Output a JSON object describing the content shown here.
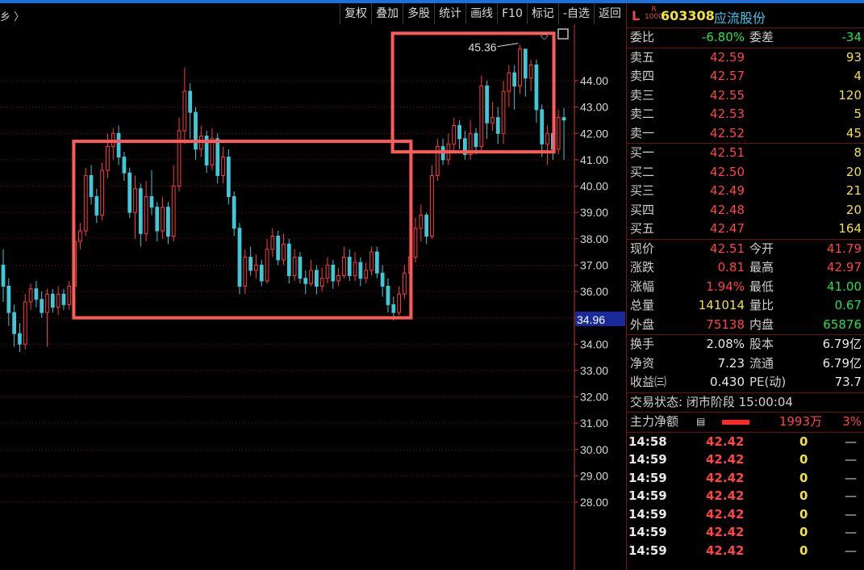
{
  "toolbar": {
    "left_fragment": "乡 〉",
    "buttons": [
      "复权",
      "叠加",
      "多股",
      "统计",
      "画线",
      "F10",
      "标记",
      "-自选",
      "返回"
    ]
  },
  "chart_data": {
    "type": "candlestick",
    "y_ticks": [
      44.0,
      43.0,
      42.0,
      41.0,
      40.0,
      39.0,
      38.0,
      37.0,
      36.0,
      35.0,
      34.0,
      33.0,
      32.0,
      31.0,
      30.0,
      29.0,
      28.0
    ],
    "ylim": [
      27.2,
      45.8
    ],
    "high_label": "45.36",
    "current_price_tag": "34.96",
    "colors": {
      "up": "#ff3b3b",
      "down": "#40c8d8",
      "box": "#ff5a5a",
      "grid": "#7a1414",
      "axis": "#d23030"
    },
    "candles": [
      [
        37.0,
        36.2,
        37.6,
        35.6
      ],
      [
        36.2,
        35.2,
        36.5,
        34.7
      ],
      [
        35.2,
        34.4,
        35.5,
        33.9
      ],
      [
        34.4,
        34.0,
        34.8,
        33.7
      ],
      [
        34.0,
        35.6,
        35.9,
        33.8
      ],
      [
        35.6,
        36.1,
        36.3,
        35.3
      ],
      [
        36.1,
        35.7,
        36.4,
        35.4
      ],
      [
        35.7,
        35.2,
        36.0,
        35.0
      ],
      [
        35.2,
        35.9,
        36.1,
        33.9
      ],
      [
        35.9,
        35.4,
        36.1,
        35.2
      ],
      [
        35.4,
        35.9,
        36.2,
        35.1
      ],
      [
        35.9,
        35.5,
        36.1,
        35.3
      ],
      [
        35.5,
        36.2,
        36.4,
        35.3
      ],
      [
        36.2,
        37.9,
        38.3,
        36.0
      ],
      [
        37.9,
        38.3,
        38.6,
        37.6
      ],
      [
        38.3,
        40.4,
        40.7,
        38.1
      ],
      [
        40.4,
        39.6,
        40.8,
        39.3
      ],
      [
        39.6,
        38.9,
        39.9,
        38.6
      ],
      [
        38.9,
        40.6,
        40.9,
        38.7
      ],
      [
        40.6,
        41.5,
        42.0,
        40.3
      ],
      [
        41.5,
        42.0,
        42.2,
        41.0
      ],
      [
        42.0,
        41.1,
        42.3,
        40.8
      ],
      [
        41.1,
        40.5,
        41.3,
        40.2
      ],
      [
        40.5,
        39.0,
        40.7,
        38.8
      ],
      [
        39.0,
        39.9,
        40.4,
        38.0
      ],
      [
        39.9,
        38.2,
        40.1,
        37.7
      ],
      [
        38.2,
        39.6,
        40.2,
        37.9
      ],
      [
        39.6,
        39.2,
        40.6,
        38.9
      ],
      [
        39.2,
        38.3,
        39.4,
        37.9
      ],
      [
        38.3,
        39.2,
        39.6,
        38.0
      ],
      [
        39.2,
        38.1,
        39.4,
        37.8
      ],
      [
        38.1,
        40.0,
        40.8,
        37.9
      ],
      [
        40.0,
        42.1,
        42.6,
        39.8
      ],
      [
        42.1,
        43.6,
        44.5,
        41.6
      ],
      [
        43.6,
        42.8,
        43.9,
        41.8
      ],
      [
        42.8,
        41.4,
        43.0,
        41.0
      ],
      [
        41.4,
        41.9,
        42.3,
        41.1
      ],
      [
        41.9,
        40.8,
        42.1,
        40.5
      ],
      [
        40.8,
        41.8,
        42.2,
        40.6
      ],
      [
        41.8,
        40.4,
        42.0,
        40.1
      ],
      [
        40.4,
        41.1,
        41.5,
        40.1
      ],
      [
        41.1,
        39.6,
        41.4,
        39.3
      ],
      [
        39.6,
        38.4,
        39.8,
        38.1
      ],
      [
        38.4,
        36.2,
        38.6,
        35.9
      ],
      [
        36.2,
        37.3,
        37.6,
        35.9
      ],
      [
        37.3,
        36.8,
        37.7,
        36.6
      ],
      [
        36.8,
        37.0,
        37.4,
        36.5
      ],
      [
        37.0,
        36.4,
        37.2,
        36.2
      ],
      [
        36.4,
        37.6,
        38.0,
        36.3
      ],
      [
        37.6,
        38.1,
        38.4,
        37.3
      ],
      [
        38.1,
        37.2,
        38.3,
        37.0
      ],
      [
        37.2,
        37.8,
        38.2,
        37.0
      ],
      [
        37.8,
        36.6,
        38.0,
        36.3
      ],
      [
        36.6,
        37.3,
        37.6,
        36.4
      ],
      [
        37.3,
        36.5,
        37.5,
        36.3
      ],
      [
        36.5,
        36.3,
        36.8,
        35.9
      ],
      [
        36.3,
        36.8,
        37.2,
        36.2
      ],
      [
        36.8,
        36.2,
        37.0,
        35.9
      ],
      [
        36.2,
        36.5,
        36.9,
        36.0
      ],
      [
        36.5,
        37.0,
        37.3,
        36.3
      ],
      [
        37.0,
        36.4,
        37.2,
        36.1
      ],
      [
        36.4,
        36.6,
        36.9,
        36.2
      ],
      [
        36.6,
        37.3,
        37.7,
        36.5
      ],
      [
        37.3,
        36.6,
        37.6,
        36.4
      ],
      [
        36.6,
        37.1,
        37.5,
        36.4
      ],
      [
        37.1,
        36.5,
        37.3,
        36.2
      ],
      [
        36.5,
        36.8,
        37.1,
        36.3
      ],
      [
        36.8,
        37.5,
        37.7,
        36.6
      ],
      [
        37.5,
        36.7,
        37.7,
        36.5
      ],
      [
        36.7,
        36.2,
        37.0,
        35.8
      ],
      [
        36.2,
        35.5,
        36.5,
        35.2
      ],
      [
        35.5,
        35.2,
        35.8,
        34.9
      ],
      [
        35.2,
        35.9,
        36.2,
        35.1
      ],
      [
        35.9,
        36.7,
        37.0,
        35.7
      ],
      [
        36.7,
        37.3,
        37.6,
        36.5
      ],
      [
        37.3,
        38.4,
        38.8,
        37.1
      ],
      [
        38.4,
        38.9,
        39.3,
        37.9
      ],
      [
        38.9,
        38.1,
        39.0,
        37.8
      ],
      [
        38.1,
        40.4,
        40.8,
        38.0
      ],
      [
        40.4,
        41.5,
        41.8,
        40.2
      ],
      [
        41.5,
        41.0,
        41.8,
        40.8
      ],
      [
        41.0,
        41.6,
        42.0,
        40.8
      ],
      [
        41.6,
        42.3,
        42.6,
        41.3
      ],
      [
        42.3,
        41.8,
        42.5,
        41.4
      ],
      [
        41.8,
        41.2,
        42.1,
        41.0
      ],
      [
        41.2,
        42.0,
        42.5,
        41.0
      ],
      [
        42.0,
        41.5,
        42.2,
        41.2
      ],
      [
        41.5,
        43.8,
        44.2,
        41.3
      ],
      [
        43.8,
        42.4,
        44.0,
        41.8
      ],
      [
        42.4,
        42.6,
        43.2,
        42.1
      ],
      [
        42.6,
        42.0,
        43.0,
        41.6
      ],
      [
        42.0,
        43.6,
        44.0,
        41.6
      ],
      [
        43.6,
        44.3,
        44.6,
        43.0
      ],
      [
        44.3,
        43.8,
        44.6,
        42.9
      ],
      [
        43.8,
        45.2,
        45.36,
        43.5
      ],
      [
        45.2,
        44.1,
        45.0,
        43.4
      ],
      [
        44.1,
        44.6,
        44.8,
        43.6
      ],
      [
        44.6,
        42.9,
        44.8,
        42.4
      ],
      [
        42.9,
        41.6,
        43.1,
        41.1
      ],
      [
        41.6,
        42.0,
        42.3,
        40.8
      ],
      [
        42.0,
        41.4,
        42.3,
        41.0
      ],
      [
        41.4,
        42.6,
        42.9,
        41.2
      ],
      [
        42.6,
        42.51,
        42.97,
        41.0
      ]
    ]
  },
  "quote": {
    "market_letter": "L",
    "badge_top": "R",
    "badge_bottom": "1000",
    "code": "603308",
    "name": "应流股份",
    "weibi_label": "委比",
    "weibi_value": "-6.80%",
    "weicha_label": "委差",
    "weicha_value": "-34",
    "sells": [
      {
        "label": "卖五",
        "price": "42.59",
        "vol": "93"
      },
      {
        "label": "卖四",
        "price": "42.57",
        "vol": "4"
      },
      {
        "label": "卖三",
        "price": "42.55",
        "vol": "120"
      },
      {
        "label": "卖二",
        "price": "42.53",
        "vol": "5"
      },
      {
        "label": "卖一",
        "price": "42.52",
        "vol": "45"
      }
    ],
    "buys": [
      {
        "label": "买一",
        "price": "42.51",
        "vol": "8"
      },
      {
        "label": "买二",
        "price": "42.50",
        "vol": "20"
      },
      {
        "label": "买三",
        "price": "42.49",
        "vol": "21"
      },
      {
        "label": "买四",
        "price": "42.48",
        "vol": "20"
      },
      {
        "label": "买五",
        "price": "42.47",
        "vol": "164"
      }
    ],
    "stats": [
      {
        "l1": "现价",
        "v1": "42.51",
        "c1": "red",
        "l2": "今开",
        "v2": "41.79",
        "c2": "red"
      },
      {
        "l1": "涨跌",
        "v1": "0.81",
        "c1": "red",
        "l2": "最高",
        "v2": "42.97",
        "c2": "red"
      },
      {
        "l1": "涨幅",
        "v1": "1.94%",
        "c1": "red",
        "l2": "最低",
        "v2": "41.00",
        "c2": "green"
      },
      {
        "l1": "总量",
        "v1": "141014",
        "c1": "yellow",
        "l2": "量比",
        "v2": "0.67",
        "c2": "green"
      },
      {
        "l1": "外盘",
        "v1": "75138",
        "c1": "red",
        "l2": "内盘",
        "v2": "65876",
        "c2": "green"
      }
    ],
    "fund": [
      {
        "l1": "换手",
        "v1": "2.08%",
        "l2": "股本",
        "v2": "6.79亿"
      },
      {
        "l1": "净资",
        "v1": "7.23",
        "l2": "流通",
        "v2": "6.79亿"
      },
      {
        "l1": "收益㈢",
        "v1": "0.430",
        "l2": "PE(动)",
        "v2": "73.7"
      }
    ],
    "trade_status": "交易状态: 闭市阶段 15:00:04",
    "main_flow_label": "主力净额",
    "main_flow_value": "1993万",
    "main_flow_pct": "3%",
    "ticks": [
      {
        "time": "14:58",
        "price": "42.42",
        "vol": "0",
        "dir": "—"
      },
      {
        "time": "14:59",
        "price": "42.42",
        "vol": "0",
        "dir": "—"
      },
      {
        "time": "14:59",
        "price": "42.42",
        "vol": "0",
        "dir": "—"
      },
      {
        "time": "14:59",
        "price": "42.42",
        "vol": "0",
        "dir": "—"
      },
      {
        "time": "14:59",
        "price": "42.42",
        "vol": "0",
        "dir": "—"
      },
      {
        "time": "14:59",
        "price": "42.42",
        "vol": "0",
        "dir": "—"
      },
      {
        "time": "14:59",
        "price": "42.42",
        "vol": "0",
        "dir": "—"
      }
    ]
  }
}
